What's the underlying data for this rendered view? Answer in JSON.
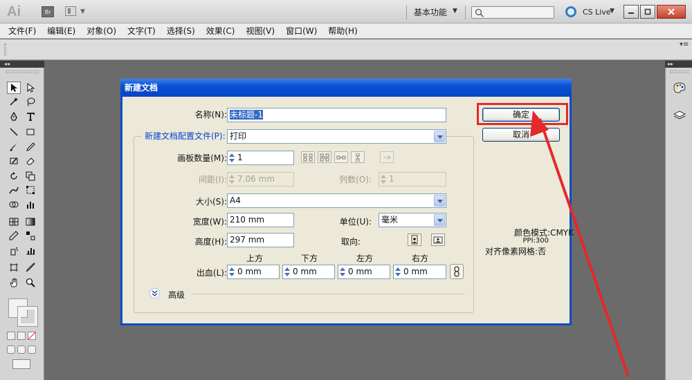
{
  "app": {
    "logo_text": "Ai",
    "bridge_label": "Br",
    "workspace_label": "基本功能",
    "cs_live_label": "CS Live",
    "search_placeholder": ""
  },
  "menu": [
    "文件(F)",
    "编辑(E)",
    "对象(O)",
    "文字(T)",
    "选择(S)",
    "效果(C)",
    "视图(V)",
    "窗口(W)",
    "帮助(H)"
  ],
  "dialog": {
    "title": "新建文档",
    "name_label": "名称(N):",
    "name_value": "未标题-1",
    "profile_label": "新建文档配置文件(P):",
    "profile_value": "打印",
    "artboards_label": "画板数量(M):",
    "artboards_value": "1",
    "spacing_label": "间距(I):",
    "spacing_value": "7.06 mm",
    "columns_label": "列数(O):",
    "columns_value": "1",
    "size_label": "大小(S):",
    "size_value": "A4",
    "width_label": "宽度(W):",
    "width_value": "210 mm",
    "units_label": "单位(U):",
    "units_value": "毫米",
    "height_label": "高度(H):",
    "height_value": "297 mm",
    "orientation_label": "取向:",
    "bleed_label": "出血(L):",
    "bleed_top_label": "上方",
    "bleed_bottom_label": "下方",
    "bleed_left_label": "左方",
    "bleed_right_label": "右方",
    "bleed_top": "0 mm",
    "bleed_bottom": "0 mm",
    "bleed_left": "0 mm",
    "bleed_right": "0 mm",
    "advanced_label": "高级",
    "ok_label": "确定",
    "cancel_label": "取消",
    "color_mode": "颜色模式:CMYK",
    "ppi": "PPI:300",
    "align_pixel": "对齐像素网格:否"
  },
  "colors": {
    "title_bar": "#0a4dc4",
    "dialog_bg": "#ece9d8",
    "annotation": "#e5282a",
    "workspace_bg": "#6b6b6b"
  }
}
